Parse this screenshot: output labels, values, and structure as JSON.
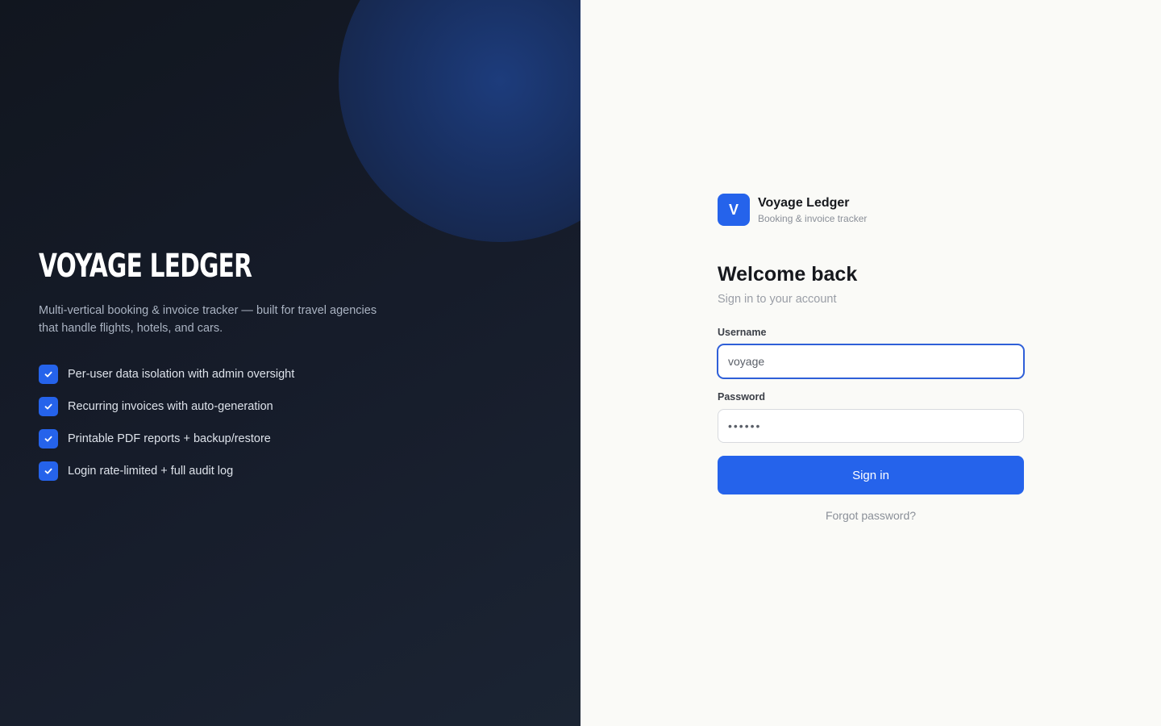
{
  "hero": {
    "title": "VOYAGE LEDGER",
    "description": "Multi-vertical booking & invoice tracker — built for travel agencies that handle flights, hotels, and cars.",
    "features": [
      "Per-user data isolation with admin oversight",
      "Recurring invoices with auto-generation",
      "Printable PDF reports + backup/restore",
      "Login rate-limited + full audit log"
    ]
  },
  "brand": {
    "logo_letter": "V",
    "name": "Voyage Ledger",
    "tagline": "Booking & invoice tracker"
  },
  "login": {
    "heading": "Welcome back",
    "subheading": "Sign in to your account",
    "username_label": "Username",
    "username_value": "voyage",
    "password_label": "Password",
    "password_value": "••••••",
    "submit_label": "Sign in",
    "forgot_label": "Forgot password?"
  },
  "colors": {
    "accent": "#2563eb",
    "hero_bg": "#161c2a",
    "panel_bg": "#fafaf7"
  },
  "icons": {
    "feature_bullet": "check-icon"
  }
}
